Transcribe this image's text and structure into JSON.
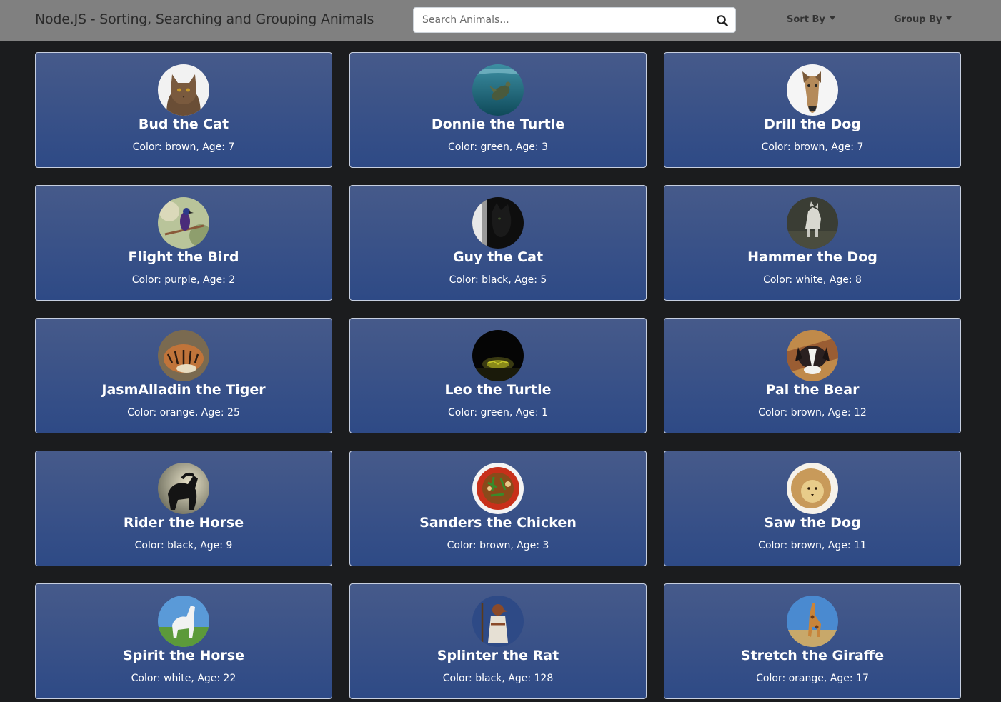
{
  "navbar": {
    "title": "Node.JS - Sorting, Searching and Grouping Animals",
    "search": {
      "placeholder": "Search Animals...",
      "value": ""
    },
    "sort_label": "Sort By",
    "group_label": "Group By"
  },
  "animals": [
    {
      "name": "Bud the Cat",
      "color": "brown",
      "age": 7,
      "details": "Color: brown, Age: 7",
      "image": "brown-cat-photo"
    },
    {
      "name": "Donnie the Turtle",
      "color": "green",
      "age": 3,
      "details": "Color: green, Age: 3",
      "image": "sea-turtle-photo"
    },
    {
      "name": "Drill the Dog",
      "color": "brown",
      "age": 7,
      "details": "Color: brown, Age: 7",
      "image": "tan-dog-photo"
    },
    {
      "name": "Flight the Bird",
      "color": "purple",
      "age": 2,
      "details": "Color: purple, Age: 2",
      "image": "purple-bird-photo"
    },
    {
      "name": "Guy the Cat",
      "color": "black",
      "age": 5,
      "details": "Color: black, Age: 5",
      "image": "black-cat-photo"
    },
    {
      "name": "Hammer the Dog",
      "color": "white",
      "age": 8,
      "details": "Color: white, Age: 8",
      "image": "white-dog-photo"
    },
    {
      "name": "JasmAlladin the Tiger",
      "color": "orange",
      "age": 25,
      "details": "Color: orange, Age: 25",
      "image": "tiger-photo"
    },
    {
      "name": "Leo the Turtle",
      "color": "green",
      "age": 1,
      "details": "Color: green, Age: 1",
      "image": "turtle-photo"
    },
    {
      "name": "Pal the Bear",
      "color": "brown",
      "age": 12,
      "details": "Color: brown, Age: 12",
      "image": "brown-white-dog-photo"
    },
    {
      "name": "Rider the Horse",
      "color": "black",
      "age": 9,
      "details": "Color: black, Age: 9",
      "image": "black-horse-photo"
    },
    {
      "name": "Sanders the Chicken",
      "color": "brown",
      "age": 3,
      "details": "Color: brown, Age: 3",
      "image": "chicken-dish-photo"
    },
    {
      "name": "Saw the Dog",
      "color": "brown",
      "age": 11,
      "details": "Color: brown, Age: 11",
      "image": "lion-photo"
    },
    {
      "name": "Spirit the Horse",
      "color": "white",
      "age": 22,
      "details": "Color: white, Age: 22",
      "image": "white-horse-photo"
    },
    {
      "name": "Splinter the Rat",
      "color": "black",
      "age": 128,
      "details": "Color: black, Age: 128",
      "image": "splinter-rat-illustration"
    },
    {
      "name": "Stretch the Giraffe",
      "color": "orange",
      "age": 17,
      "details": "Color: orange, Age: 17",
      "image": "giraffe-photo"
    }
  ]
}
